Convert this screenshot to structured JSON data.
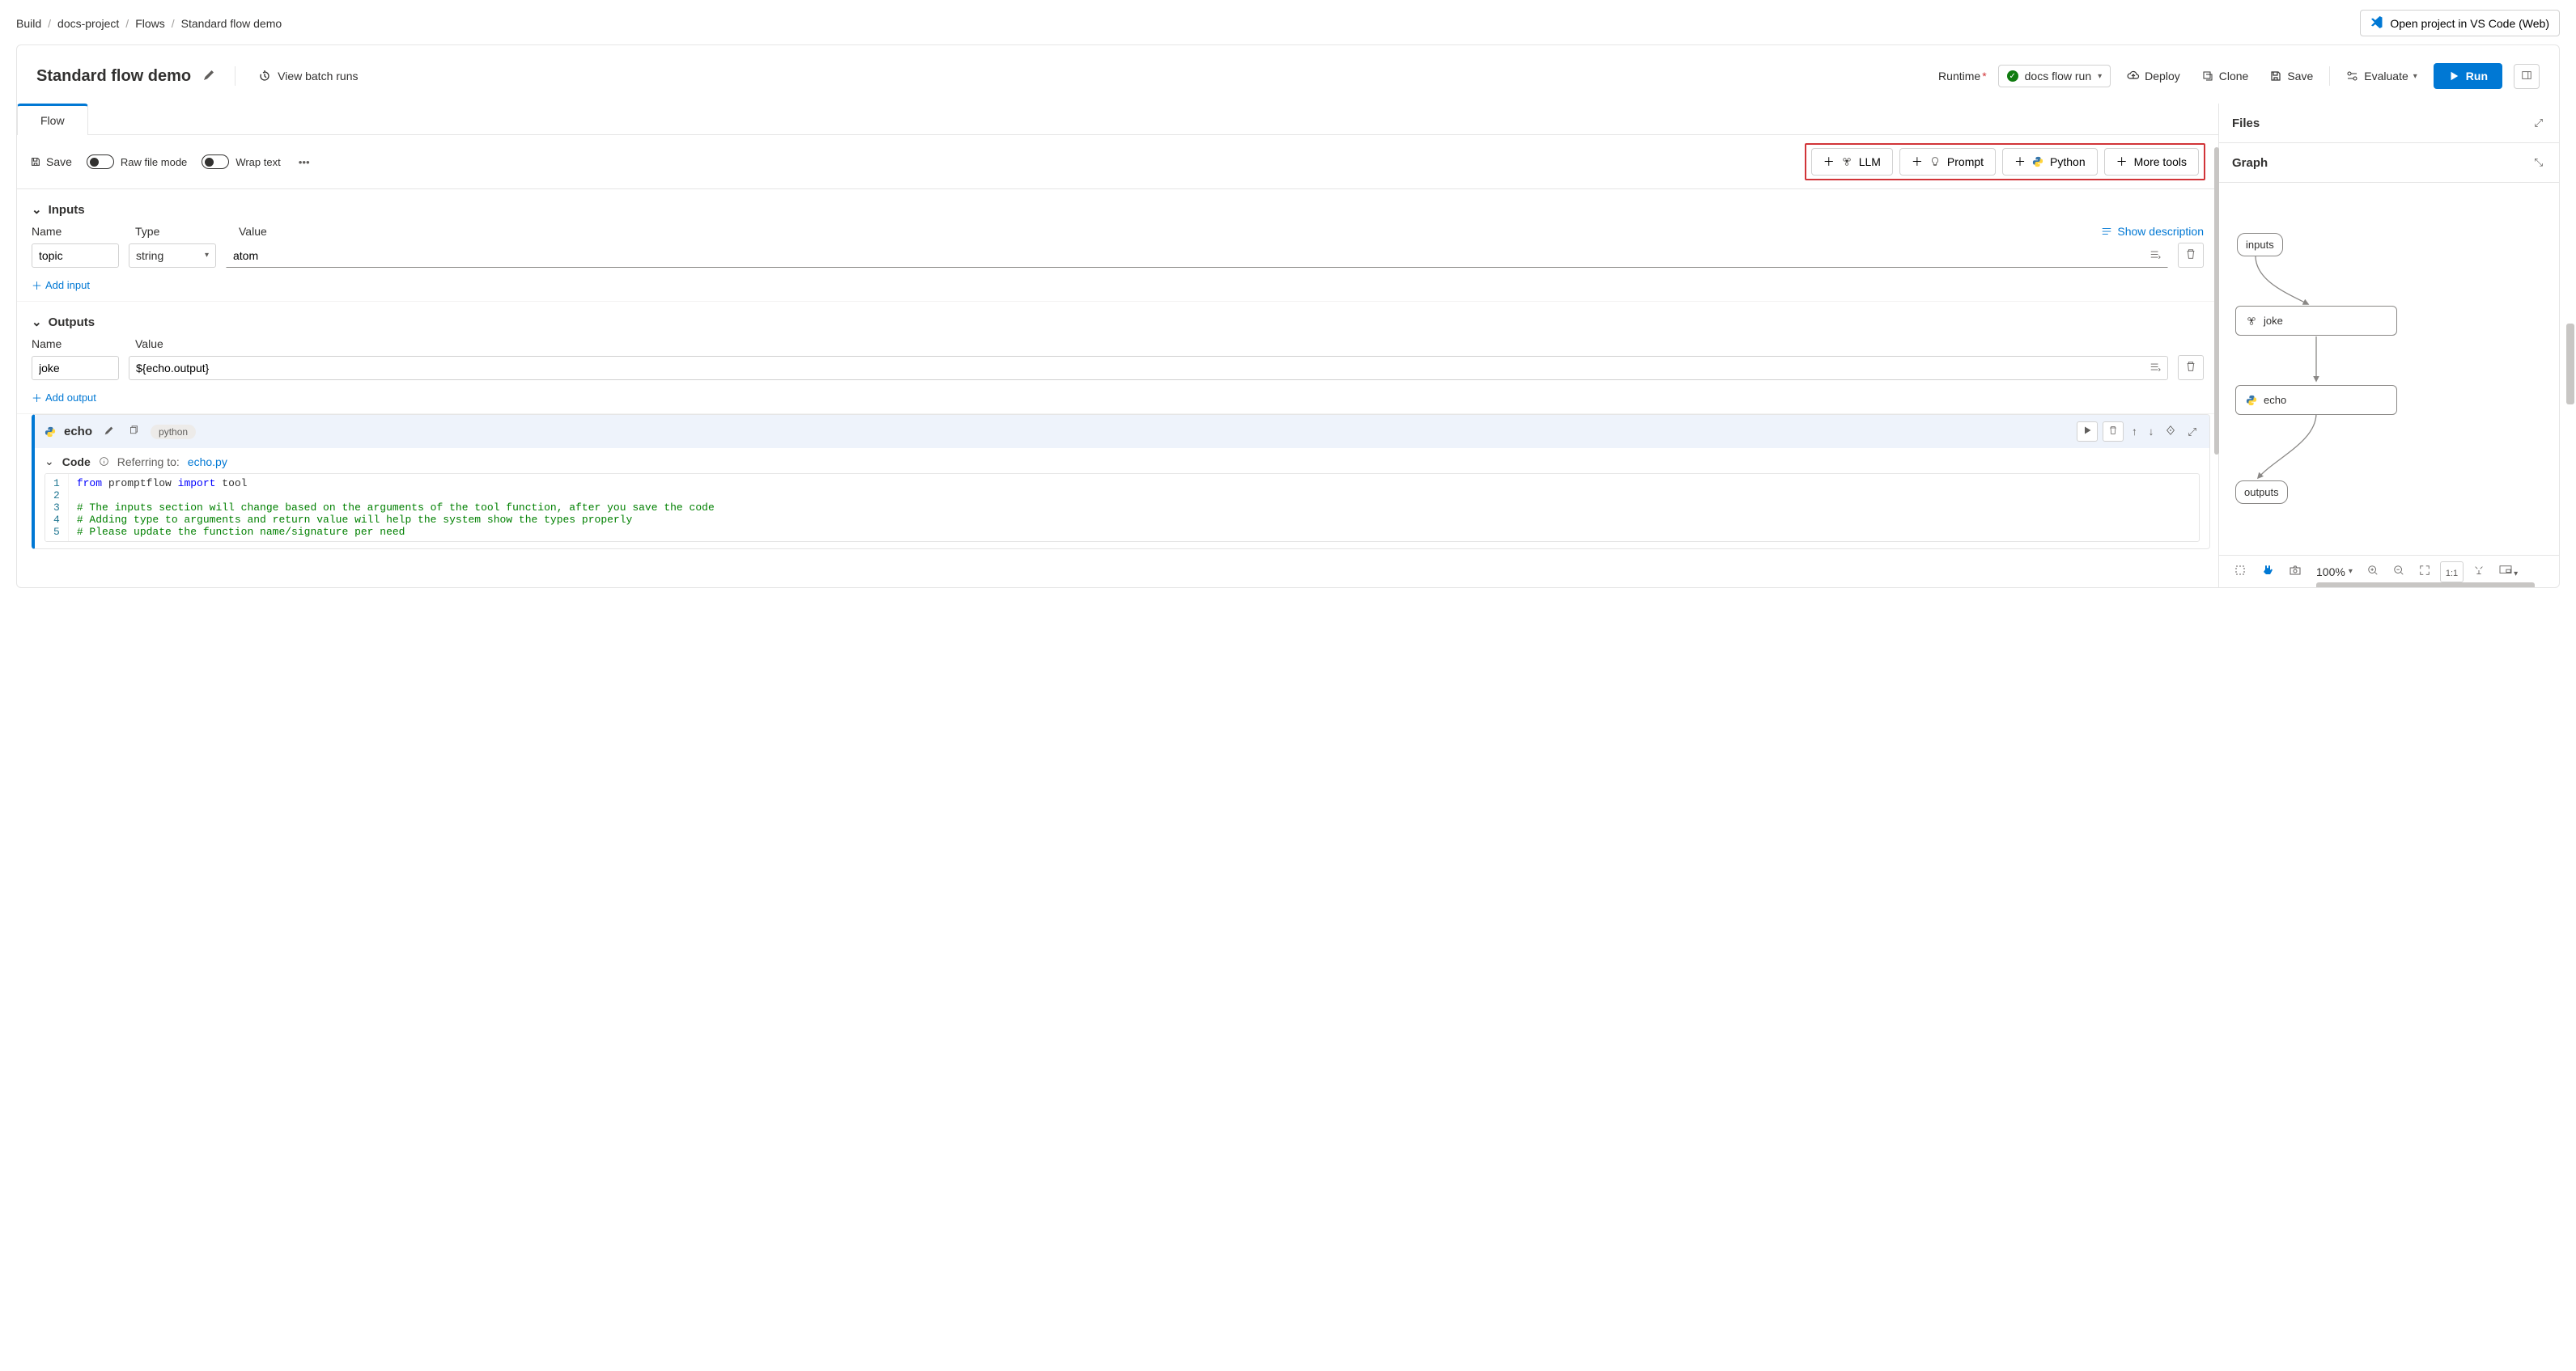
{
  "breadcrumb": {
    "items": [
      "Build",
      "docs-project",
      "Flows",
      "Standard flow demo"
    ]
  },
  "vscode_button": "Open project in VS Code (Web)",
  "header": {
    "title": "Standard flow demo",
    "view_batch": "View batch runs",
    "runtime_label": "Runtime",
    "runtime_value": "docs flow run",
    "deploy": "Deploy",
    "clone": "Clone",
    "save": "Save",
    "evaluate": "Evaluate",
    "run": "Run"
  },
  "tabs": {
    "flow": "Flow"
  },
  "toolbar": {
    "save": "Save",
    "raw": "Raw file mode",
    "wrap": "Wrap text",
    "add_llm": "LLM",
    "add_prompt": "Prompt",
    "add_python": "Python",
    "more_tools": "More tools"
  },
  "inputs": {
    "title": "Inputs",
    "col_name": "Name",
    "col_type": "Type",
    "col_value": "Value",
    "show_desc": "Show description",
    "rows": [
      {
        "name": "topic",
        "type": "string",
        "value": "atom"
      }
    ],
    "add": "Add input"
  },
  "outputs": {
    "title": "Outputs",
    "col_name": "Name",
    "col_value": "Value",
    "rows": [
      {
        "name": "joke",
        "value": "${echo.output}"
      }
    ],
    "add": "Add output"
  },
  "node": {
    "name": "echo",
    "lang": "python",
    "code_title": "Code",
    "referring": "Referring to:",
    "ref_file": "echo.py",
    "lines": [
      {
        "n": "1",
        "html": "<span class='kw'>from</span> promptflow <span class='kw'>import</span> tool"
      },
      {
        "n": "2",
        "html": ""
      },
      {
        "n": "3",
        "html": "<span class='cmt'># The inputs section will change based on the arguments of the tool function, after you save the code</span>"
      },
      {
        "n": "4",
        "html": "<span class='cmt'># Adding type to arguments and return value will help the system show the types properly</span>"
      },
      {
        "n": "5",
        "html": "<span class='cmt'># Please update the function name/signature per need</span>"
      }
    ]
  },
  "right": {
    "files_title": "Files",
    "graph_title": "Graph",
    "nodes": {
      "inputs": "inputs",
      "joke": "joke",
      "echo": "echo",
      "outputs": "outputs"
    },
    "zoom": "100%"
  }
}
